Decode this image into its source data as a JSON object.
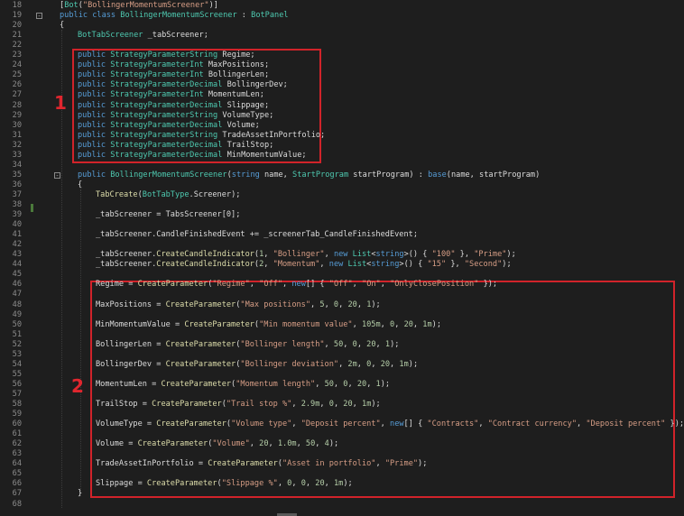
{
  "lines": [
    {
      "n": "18",
      "indent": 66,
      "t": [
        [
          "pl",
          "["
        ],
        [
          "ty",
          "Bot"
        ],
        [
          "pl",
          "("
        ],
        [
          "st",
          "\"BollingerMomentumScreener\""
        ],
        [
          "pl",
          ")]"
        ]
      ]
    },
    {
      "n": "19",
      "indent": 66,
      "fold": "-",
      "t": [
        [
          "kw",
          "public class "
        ],
        [
          "ty",
          "BollingerMomentumScreener"
        ],
        [
          "pl",
          " : "
        ],
        [
          "ty",
          "BotPanel"
        ]
      ]
    },
    {
      "n": "20",
      "indent": 66,
      "t": [
        [
          "pl",
          "{"
        ]
      ]
    },
    {
      "n": "21",
      "indent": 86,
      "t": [
        [
          "ty",
          "BotTabScreener"
        ],
        [
          "pl",
          " _tabScreener;"
        ]
      ]
    },
    {
      "n": "22",
      "indent": 86,
      "t": []
    },
    {
      "n": "23",
      "indent": 86,
      "t": [
        [
          "kw",
          "public "
        ],
        [
          "ty",
          "StrategyParameterString"
        ],
        [
          "pl",
          " Regime;"
        ]
      ]
    },
    {
      "n": "24",
      "indent": 86,
      "t": [
        [
          "kw",
          "public "
        ],
        [
          "ty",
          "StrategyParameterInt"
        ],
        [
          "pl",
          " MaxPositions;"
        ]
      ]
    },
    {
      "n": "25",
      "indent": 86,
      "t": [
        [
          "kw",
          "public "
        ],
        [
          "ty",
          "StrategyParameterInt"
        ],
        [
          "pl",
          " BollingerLen;"
        ]
      ]
    },
    {
      "n": "26",
      "indent": 86,
      "t": [
        [
          "kw",
          "public "
        ],
        [
          "ty",
          "StrategyParameterDecimal"
        ],
        [
          "pl",
          " BollingerDev;"
        ]
      ]
    },
    {
      "n": "27",
      "indent": 86,
      "t": [
        [
          "kw",
          "public "
        ],
        [
          "ty",
          "StrategyParameterInt"
        ],
        [
          "pl",
          " MomentumLen;"
        ]
      ]
    },
    {
      "n": "28",
      "indent": 86,
      "t": [
        [
          "kw",
          "public "
        ],
        [
          "ty",
          "StrategyParameterDecimal"
        ],
        [
          "pl",
          " Slippage;"
        ]
      ]
    },
    {
      "n": "29",
      "indent": 86,
      "t": [
        [
          "kw",
          "public "
        ],
        [
          "ty",
          "StrategyParameterString"
        ],
        [
          "pl",
          " VolumeType;"
        ]
      ]
    },
    {
      "n": "30",
      "indent": 86,
      "t": [
        [
          "kw",
          "public "
        ],
        [
          "ty",
          "StrategyParameterDecimal"
        ],
        [
          "pl",
          " Volume;"
        ]
      ]
    },
    {
      "n": "31",
      "indent": 86,
      "t": [
        [
          "kw",
          "public "
        ],
        [
          "ty",
          "StrategyParameterString"
        ],
        [
          "pl",
          " TradeAssetInPortfolio;"
        ]
      ]
    },
    {
      "n": "32",
      "indent": 86,
      "t": [
        [
          "kw",
          "public "
        ],
        [
          "ty",
          "StrategyParameterDecimal"
        ],
        [
          "pl",
          " TrailStop;"
        ]
      ]
    },
    {
      "n": "33",
      "indent": 86,
      "t": [
        [
          "kw",
          "public "
        ],
        [
          "ty",
          "StrategyParameterDecimal"
        ],
        [
          "pl",
          " MinMomentumValue;"
        ]
      ]
    },
    {
      "n": "34",
      "indent": 86,
      "t": []
    },
    {
      "n": "35",
      "indent": 86,
      "fold": "-",
      "t": [
        [
          "kw",
          "public "
        ],
        [
          "ty",
          "BollingerMomentumScreener"
        ],
        [
          "pl",
          "("
        ],
        [
          "kw",
          "string"
        ],
        [
          "pl",
          " name, "
        ],
        [
          "ty",
          "StartProgram"
        ],
        [
          "pl",
          " startProgram) : "
        ],
        [
          "kw",
          "base"
        ],
        [
          "pl",
          "(name, startProgram)"
        ]
      ]
    },
    {
      "n": "36",
      "indent": 86,
      "t": [
        [
          "pl",
          "{"
        ]
      ]
    },
    {
      "n": "37",
      "indent": 106,
      "t": [
        [
          "mt",
          "TabCreate"
        ],
        [
          "pl",
          "("
        ],
        [
          "ty",
          "BotTabType"
        ],
        [
          "pl",
          ".Screener);"
        ]
      ]
    },
    {
      "n": "38",
      "indent": 106,
      "t": []
    },
    {
      "n": "39",
      "indent": 106,
      "t": [
        [
          "pl",
          "_tabScreener = TabsScreener[0];"
        ]
      ]
    },
    {
      "n": "40",
      "indent": 106,
      "t": []
    },
    {
      "n": "41",
      "indent": 106,
      "t": [
        [
          "pl",
          "_tabScreener.CandleFinishedEvent += _screenerTab_CandleFinishedEvent;"
        ]
      ]
    },
    {
      "n": "42",
      "indent": 106,
      "t": []
    },
    {
      "n": "43",
      "indent": 106,
      "t": [
        [
          "pl",
          "_tabScreener."
        ],
        [
          "mt",
          "CreateCandleIndicator"
        ],
        [
          "pl",
          "("
        ],
        [
          "nu",
          "1"
        ],
        [
          "pl",
          ", "
        ],
        [
          "st",
          "\"Bollinger\""
        ],
        [
          "pl",
          ", "
        ],
        [
          "kw",
          "new "
        ],
        [
          "ty",
          "List"
        ],
        [
          "pl",
          "<"
        ],
        [
          "kw",
          "string"
        ],
        [
          "pl",
          ">() { "
        ],
        [
          "st",
          "\"100\""
        ],
        [
          "pl",
          " }, "
        ],
        [
          "st",
          "\"Prime\""
        ],
        [
          "pl",
          ");"
        ]
      ]
    },
    {
      "n": "44",
      "indent": 106,
      "t": [
        [
          "pl",
          "_tabScreener."
        ],
        [
          "mt",
          "CreateCandleIndicator"
        ],
        [
          "pl",
          "("
        ],
        [
          "nu",
          "2"
        ],
        [
          "pl",
          ", "
        ],
        [
          "st",
          "\"Momentum\""
        ],
        [
          "pl",
          ", "
        ],
        [
          "kw",
          "new "
        ],
        [
          "ty",
          "List"
        ],
        [
          "pl",
          "<"
        ],
        [
          "kw",
          "string"
        ],
        [
          "pl",
          ">() { "
        ],
        [
          "st",
          "\"15\""
        ],
        [
          "pl",
          " }, "
        ],
        [
          "st",
          "\"Second\""
        ],
        [
          "pl",
          ");"
        ]
      ]
    },
    {
      "n": "45",
      "indent": 106,
      "t": []
    },
    {
      "n": "46",
      "indent": 106,
      "t": [
        [
          "pl",
          "Regime = "
        ],
        [
          "mt",
          "CreateParameter"
        ],
        [
          "pl",
          "("
        ],
        [
          "st",
          "\"Regime\""
        ],
        [
          "pl",
          ", "
        ],
        [
          "st",
          "\"Off\""
        ],
        [
          "pl",
          ", "
        ],
        [
          "kw",
          "new"
        ],
        [
          "pl",
          "[] { "
        ],
        [
          "st",
          "\"Off\""
        ],
        [
          "pl",
          ", "
        ],
        [
          "st",
          "\"On\""
        ],
        [
          "pl",
          ", "
        ],
        [
          "st",
          "\"OnlyClosePosition\""
        ],
        [
          "pl",
          " });"
        ]
      ]
    },
    {
      "n": "47",
      "indent": 106,
      "t": []
    },
    {
      "n": "48",
      "indent": 106,
      "t": [
        [
          "pl",
          "MaxPositions = "
        ],
        [
          "mt",
          "CreateParameter"
        ],
        [
          "pl",
          "("
        ],
        [
          "st",
          "\"Max positions\""
        ],
        [
          "pl",
          ", "
        ],
        [
          "nu",
          "5"
        ],
        [
          "pl",
          ", "
        ],
        [
          "nu",
          "0"
        ],
        [
          "pl",
          ", "
        ],
        [
          "nu",
          "20"
        ],
        [
          "pl",
          ", "
        ],
        [
          "nu",
          "1"
        ],
        [
          "pl",
          ");"
        ]
      ]
    },
    {
      "n": "49",
      "indent": 106,
      "t": []
    },
    {
      "n": "50",
      "indent": 106,
      "t": [
        [
          "pl",
          "MinMomentumValue = "
        ],
        [
          "mt",
          "CreateParameter"
        ],
        [
          "pl",
          "("
        ],
        [
          "st",
          "\"Min momentum value\""
        ],
        [
          "pl",
          ", "
        ],
        [
          "nu",
          "105m"
        ],
        [
          "pl",
          ", "
        ],
        [
          "nu",
          "0"
        ],
        [
          "pl",
          ", "
        ],
        [
          "nu",
          "20"
        ],
        [
          "pl",
          ", "
        ],
        [
          "nu",
          "1m"
        ],
        [
          "pl",
          ");"
        ]
      ]
    },
    {
      "n": "51",
      "indent": 106,
      "t": []
    },
    {
      "n": "52",
      "indent": 106,
      "t": [
        [
          "pl",
          "BollingerLen = "
        ],
        [
          "mt",
          "CreateParameter"
        ],
        [
          "pl",
          "("
        ],
        [
          "st",
          "\"Bollinger length\""
        ],
        [
          "pl",
          ", "
        ],
        [
          "nu",
          "50"
        ],
        [
          "pl",
          ", "
        ],
        [
          "nu",
          "0"
        ],
        [
          "pl",
          ", "
        ],
        [
          "nu",
          "20"
        ],
        [
          "pl",
          ", "
        ],
        [
          "nu",
          "1"
        ],
        [
          "pl",
          ");"
        ]
      ]
    },
    {
      "n": "53",
      "indent": 106,
      "t": []
    },
    {
      "n": "54",
      "indent": 106,
      "t": [
        [
          "pl",
          "BollingerDev = "
        ],
        [
          "mt",
          "CreateParameter"
        ],
        [
          "pl",
          "("
        ],
        [
          "st",
          "\"Bollinger deviation\""
        ],
        [
          "pl",
          ", "
        ],
        [
          "nu",
          "2m"
        ],
        [
          "pl",
          ", "
        ],
        [
          "nu",
          "0"
        ],
        [
          "pl",
          ", "
        ],
        [
          "nu",
          "20"
        ],
        [
          "pl",
          ", "
        ],
        [
          "nu",
          "1m"
        ],
        [
          "pl",
          ");"
        ]
      ]
    },
    {
      "n": "55",
      "indent": 106,
      "t": []
    },
    {
      "n": "56",
      "indent": 106,
      "t": [
        [
          "pl",
          "MomentumLen = "
        ],
        [
          "mt",
          "CreateParameter"
        ],
        [
          "pl",
          "("
        ],
        [
          "st",
          "\"Momentum length\""
        ],
        [
          "pl",
          ", "
        ],
        [
          "nu",
          "50"
        ],
        [
          "pl",
          ", "
        ],
        [
          "nu",
          "0"
        ],
        [
          "pl",
          ", "
        ],
        [
          "nu",
          "20"
        ],
        [
          "pl",
          ", "
        ],
        [
          "nu",
          "1"
        ],
        [
          "pl",
          ");"
        ]
      ]
    },
    {
      "n": "57",
      "indent": 106,
      "t": []
    },
    {
      "n": "58",
      "indent": 106,
      "t": [
        [
          "pl",
          "TrailStop = "
        ],
        [
          "mt",
          "CreateParameter"
        ],
        [
          "pl",
          "("
        ],
        [
          "st",
          "\"Trail stop %\""
        ],
        [
          "pl",
          ", "
        ],
        [
          "nu",
          "2.9m"
        ],
        [
          "pl",
          ", "
        ],
        [
          "nu",
          "0"
        ],
        [
          "pl",
          ", "
        ],
        [
          "nu",
          "20"
        ],
        [
          "pl",
          ", "
        ],
        [
          "nu",
          "1m"
        ],
        [
          "pl",
          ");"
        ]
      ]
    },
    {
      "n": "59",
      "indent": 106,
      "t": []
    },
    {
      "n": "60",
      "indent": 106,
      "t": [
        [
          "pl",
          "VolumeType = "
        ],
        [
          "mt",
          "CreateParameter"
        ],
        [
          "pl",
          "("
        ],
        [
          "st",
          "\"Volume type\""
        ],
        [
          "pl",
          ", "
        ],
        [
          "st",
          "\"Deposit percent\""
        ],
        [
          "pl",
          ", "
        ],
        [
          "kw",
          "new"
        ],
        [
          "pl",
          "[] { "
        ],
        [
          "st",
          "\"Contracts\""
        ],
        [
          "pl",
          ", "
        ],
        [
          "st",
          "\"Contract currency\""
        ],
        [
          "pl",
          ", "
        ],
        [
          "st",
          "\"Deposit percent\""
        ],
        [
          "pl",
          " });"
        ]
      ]
    },
    {
      "n": "61",
      "indent": 106,
      "t": []
    },
    {
      "n": "62",
      "indent": 106,
      "t": [
        [
          "pl",
          "Volume = "
        ],
        [
          "mt",
          "CreateParameter"
        ],
        [
          "pl",
          "("
        ],
        [
          "st",
          "\"Volume\""
        ],
        [
          "pl",
          ", "
        ],
        [
          "nu",
          "20"
        ],
        [
          "pl",
          ", "
        ],
        [
          "nu",
          "1.0m"
        ],
        [
          "pl",
          ", "
        ],
        [
          "nu",
          "50"
        ],
        [
          "pl",
          ", "
        ],
        [
          "nu",
          "4"
        ],
        [
          "pl",
          ");"
        ]
      ]
    },
    {
      "n": "63",
      "indent": 106,
      "t": []
    },
    {
      "n": "64",
      "indent": 106,
      "t": [
        [
          "pl",
          "TradeAssetInPortfolio = "
        ],
        [
          "mt",
          "CreateParameter"
        ],
        [
          "pl",
          "("
        ],
        [
          "st",
          "\"Asset in portfolio\""
        ],
        [
          "pl",
          ", "
        ],
        [
          "st",
          "\"Prime\""
        ],
        [
          "pl",
          ");"
        ]
      ]
    },
    {
      "n": "65",
      "indent": 106,
      "t": []
    },
    {
      "n": "66",
      "indent": 106,
      "t": [
        [
          "pl",
          "Slippage = "
        ],
        [
          "mt",
          "CreateParameter"
        ],
        [
          "pl",
          "("
        ],
        [
          "st",
          "\"Slippage %\""
        ],
        [
          "pl",
          ", "
        ],
        [
          "nu",
          "0"
        ],
        [
          "pl",
          ", "
        ],
        [
          "nu",
          "0"
        ],
        [
          "pl",
          ", "
        ],
        [
          "nu",
          "20"
        ],
        [
          "pl",
          ", "
        ],
        [
          "nu",
          "1m"
        ],
        [
          "pl",
          ");"
        ]
      ]
    },
    {
      "n": "67",
      "indent": 86,
      "t": [
        [
          "pl",
          "}"
        ]
      ]
    },
    {
      "n": "68",
      "indent": 86,
      "t": []
    }
  ],
  "annotations": {
    "label_1": "1",
    "label_2": "2"
  },
  "colors": {
    "background": "#1e1e1e",
    "keyword": "#569cd6",
    "type": "#4ec9b0",
    "string": "#d69d85",
    "method": "#dcdcaa",
    "number": "#b5cea8",
    "highlight_box": "#d1232a"
  }
}
